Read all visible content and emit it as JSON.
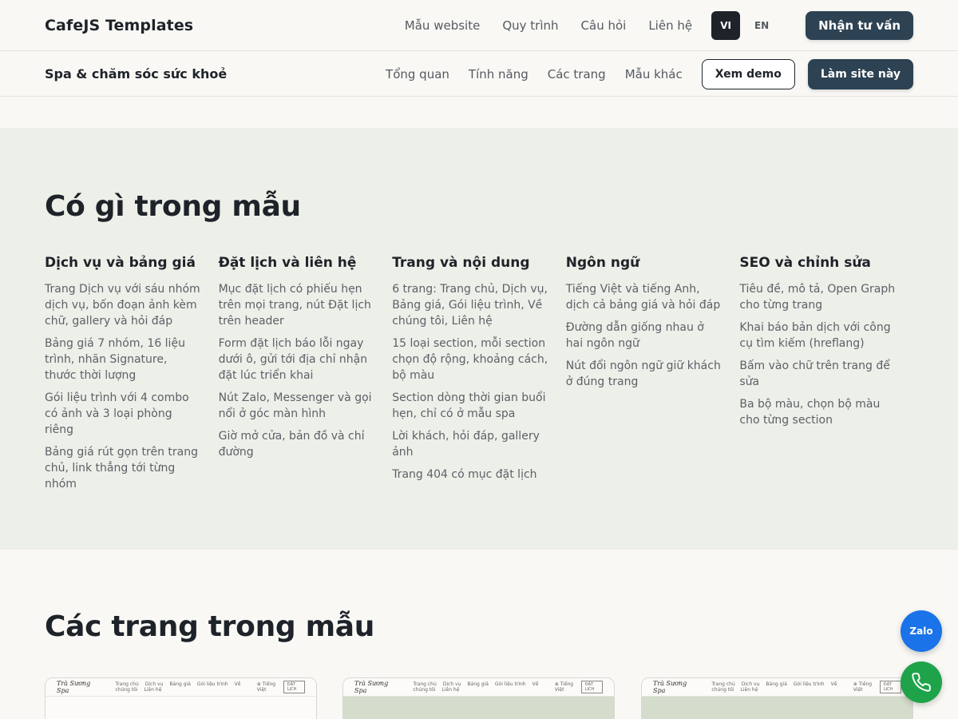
{
  "header": {
    "brand": "CafeJS Templates",
    "nav": [
      "Mẫu website",
      "Quy trình",
      "Câu hỏi",
      "Liên hệ"
    ],
    "lang_vi": "VI",
    "lang_en": "EN",
    "cta": "Nhận tư vấn"
  },
  "subheader": {
    "title": "Spa & chăm sóc sức khoẻ",
    "nav": [
      "Tổng quan",
      "Tính năng",
      "Các trang",
      "Mẫu khác"
    ],
    "demo_button": "Xem demo",
    "build_button": "Làm site này"
  },
  "features": {
    "title": "Có gì trong mẫu",
    "columns": [
      {
        "heading": "Dịch vụ và bảng giá",
        "items": [
          "Trang Dịch vụ với sáu nhóm dịch vụ, bốn đoạn ảnh kèm chữ, gallery và hỏi đáp",
          "Bảng giá 7 nhóm, 16 liệu trình, nhãn Signature, thước thời lượng",
          "Gói liệu trình với 4 combo có ảnh và 3 loại phòng riêng",
          "Bảng giá rút gọn trên trang chủ, link thẳng tới từng nhóm"
        ]
      },
      {
        "heading": "Đặt lịch và liên hệ",
        "items": [
          "Mục đặt lịch có phiếu hẹn trên mọi trang, nút Đặt lịch trên header",
          "Form đặt lịch báo lỗi ngay dưới ô, gửi tới địa chỉ nhận đặt lúc triển khai",
          "Nút Zalo, Messenger và gọi nổi ở góc màn hình",
          "Giờ mở cửa, bản đồ và chỉ đường"
        ]
      },
      {
        "heading": "Trang và nội dung",
        "items": [
          "6 trang: Trang chủ, Dịch vụ, Bảng giá, Gói liệu trình, Về chúng tôi, Liên hệ",
          "15 loại section, mỗi section chọn độ rộng, khoảng cách, bộ màu",
          "Section dòng thời gian buổi hẹn, chỉ có ở mẫu spa",
          "Lời khách, hỏi đáp, gallery ảnh",
          "Trang 404 có mục đặt lịch"
        ]
      },
      {
        "heading": "Ngôn ngữ",
        "items": [
          "Tiếng Việt và tiếng Anh, dịch cả bảng giá và hỏi đáp",
          "Đường dẫn giống nhau ở hai ngôn ngữ",
          "Nút đổi ngôn ngữ giữ khách ở đúng trang"
        ]
      },
      {
        "heading": "SEO và chỉnh sửa",
        "items": [
          "Tiêu đề, mô tả, Open Graph cho từng trang",
          "Khai báo bản dịch với công cụ tìm kiếm (hreflang)",
          "Bấm vào chữ trên trang để sửa",
          "Ba bộ màu, chọn bộ màu cho từng section"
        ]
      }
    ]
  },
  "pages": {
    "title": "Các trang trong mẫu",
    "thumb_logo": "Trà Sương Spa",
    "thumb_nav": [
      "Trang chủ",
      "Dịch vụ",
      "Bảng giá",
      "Gói liệu trình",
      "Về chúng tôi",
      "Liên hệ"
    ],
    "thumb_lang": "⊕ Tiếng Việt",
    "thumb_button": "ĐẶT LỊCH"
  },
  "floating": {
    "zalo": "Zalo",
    "phone_icon": "phone-icon"
  },
  "colors": {
    "primary": "#2d4252",
    "features_bg": "#edefe9",
    "zalo": "#1a73e8",
    "phone": "#1fa34a"
  }
}
